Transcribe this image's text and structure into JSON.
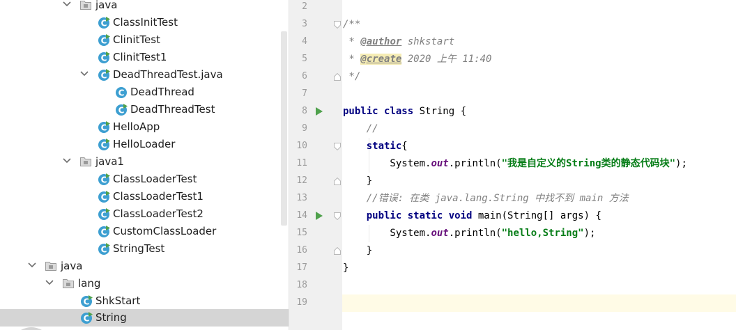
{
  "tree": {
    "items": [
      {
        "label": "java",
        "kind": "package",
        "expanded": true
      },
      {
        "label": "ClassInitTest",
        "kind": "class"
      },
      {
        "label": "ClinitTest",
        "kind": "class"
      },
      {
        "label": "ClinitTest1",
        "kind": "class"
      },
      {
        "label": "DeadThreadTest.java",
        "kind": "file",
        "expanded": true
      },
      {
        "label": "DeadThread",
        "kind": "class"
      },
      {
        "label": "DeadThreadTest",
        "kind": "class"
      },
      {
        "label": "HelloApp",
        "kind": "class"
      },
      {
        "label": "HelloLoader",
        "kind": "class"
      },
      {
        "label": "java1",
        "kind": "package",
        "expanded": true
      },
      {
        "label": "ClassLoaderTest",
        "kind": "class"
      },
      {
        "label": "ClassLoaderTest1",
        "kind": "class"
      },
      {
        "label": "ClassLoaderTest2",
        "kind": "class"
      },
      {
        "label": "CustomClassLoader",
        "kind": "class"
      },
      {
        "label": "StringTest",
        "kind": "class"
      },
      {
        "label": "java",
        "kind": "package",
        "expanded": true
      },
      {
        "label": "lang",
        "kind": "package",
        "expanded": true
      },
      {
        "label": "ShkStart",
        "kind": "class"
      },
      {
        "label": "String",
        "kind": "class",
        "selected": true
      }
    ]
  },
  "editor": {
    "line_numbers": [
      "2",
      "3",
      "4",
      "5",
      "6",
      "7",
      "8",
      "9",
      "10",
      "11",
      "12",
      "13",
      "14",
      "15",
      "16",
      "17",
      "18",
      "19"
    ],
    "current_line": "19",
    "code": {
      "l3": "/**",
      "l4_star": " * ",
      "l4_tag": "@author",
      "l4_text": " shkstart",
      "l5_star": " * ",
      "l5_tag": "@create",
      "l5_text": " 2020 上午 11:40",
      "l6": " */",
      "l8_kw": "public class",
      "l8_rest": " String {",
      "l9": "    //",
      "l10_kw": "    static",
      "l10_rest": "{",
      "l11_pre": "        System.",
      "l11_fld": "out",
      "l11_mid": ".println(",
      "l11_str": "\"我是自定义的String类的静态代码块\"",
      "l11_end": ");",
      "l12": "    }",
      "l13": "    //错误: 在类 java.lang.String 中找不到 main 方法",
      "l14_kw": "    public static void",
      "l14_rest": " main(String[] args) {",
      "l15_pre": "        System.",
      "l15_fld": "out",
      "l15_mid": ".println(",
      "l15_str": "\"hello,String\"",
      "l15_end": ");",
      "l16": "    }",
      "l17": "}"
    }
  },
  "colors": {
    "keyword": "#000080",
    "comment": "#808080",
    "string": "#067d17",
    "field": "#660e7a",
    "run_icon": "#4fa14c",
    "class_icon": "#3d9fd1",
    "selection": "#d5d5d5",
    "current_line": "#fffbe6"
  },
  "icons": {
    "class": "java-class-icon",
    "package": "package-folder-icon",
    "expand": "chevron-down-icon",
    "run": "run-gutter-icon",
    "fold": "fold-marker-icon"
  }
}
